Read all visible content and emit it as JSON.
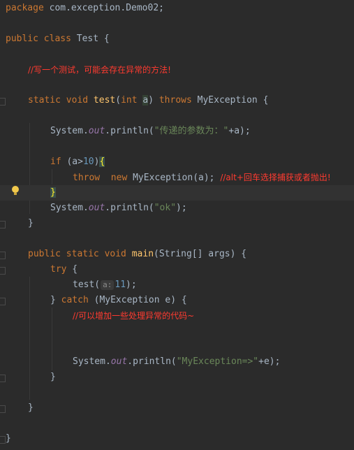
{
  "editor": {
    "file_language": "java",
    "colors": {
      "background": "#2b2b2b",
      "keyword": "#cc7832",
      "string": "#6a8759",
      "number": "#6897bb",
      "method": "#ffc66d",
      "static_field": "#9876aa",
      "comment": "#ff3b30"
    },
    "lines": {
      "l1_kw": "package",
      "l1_rest": " com.exception.Demo02;",
      "l3_kw": "public class",
      "l3_rest": " Test {",
      "l5_comment": "//写一个测试，可能会存在异常的方法!",
      "l7_kw1": "static void",
      "l7_fn": "test",
      "l7_p1": "(",
      "l7_kw2": "int",
      "l7_param": "a",
      "l7_p2": ") ",
      "l7_kw3": "throws",
      "l7_rest": " MyException {",
      "l9_a": "System.",
      "l9_field": "out",
      "l9_b": ".println(",
      "l9_str": "\"传递的参数为：\"",
      "l9_c": "+a);",
      "l11_kw": "if",
      "l11_a": " (a>",
      "l11_num": "10",
      "l11_b": ")",
      "l11_brace": "{",
      "l12_kw1": "throw",
      "l12_kw2": "new",
      "l12_rest": " MyException(a); ",
      "l12_comment": "//alt+回车选择捕获或者抛出!",
      "l13_brace": "}",
      "l14_a": "System.",
      "l14_field": "out",
      "l14_b": ".println(",
      "l14_str": "\"ok\"",
      "l14_c": ");",
      "l15": "}",
      "l17_kw": "public static void",
      "l17_fn": "main",
      "l17_rest": "(String[] args) {",
      "l18_kw": "try",
      "l18_rest": " {",
      "l19_a": "test(",
      "l19_hint": "a:",
      "l19_num": "11",
      "l19_b": ");",
      "l20_a": "} ",
      "l20_kw": "catch",
      "l20_rest": " (MyException e) {",
      "l21_comment": "//可以增加一些处理异常的代码~",
      "l24_a": "System.",
      "l24_field": "out",
      "l24_b": ".println(",
      "l24_str": "\"MyException=>\"",
      "l24_c": "+e);",
      "l25": "}",
      "l27": "}",
      "l29": "}"
    },
    "intention_icon": "lightbulb-icon"
  }
}
